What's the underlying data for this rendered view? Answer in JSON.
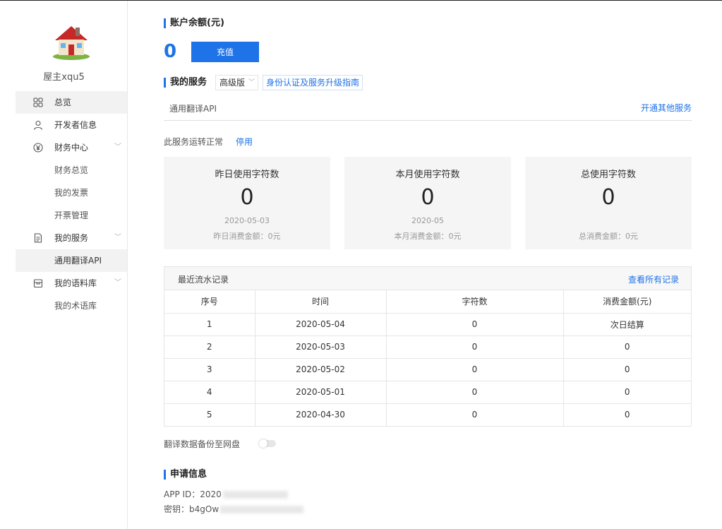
{
  "sidebar": {
    "username": "屋主xqu5",
    "items": [
      {
        "label": "总览",
        "icon": "overview-grid-icon"
      },
      {
        "label": "开发者信息",
        "icon": "user-icon"
      },
      {
        "label": "财务中心",
        "icon": "yuan-icon",
        "sub": [
          "财务总览",
          "我的发票",
          "开票管理"
        ]
      },
      {
        "label": "我的服务",
        "icon": "document-icon",
        "sub": [
          "通用翻译API"
        ]
      },
      {
        "label": "我的语料库",
        "icon": "box-icon",
        "sub": [
          "我的术语库"
        ]
      }
    ]
  },
  "account": {
    "title": "账户余额(元)",
    "balance": "0",
    "recharge_label": "充值"
  },
  "service": {
    "title": "我的服务",
    "tier": "高级版",
    "guide_link": "身份认证及服务升级指南",
    "tab": "通用翻译API",
    "open_other": "开通其他服务",
    "status": "此服务运转正常",
    "stop_label": "停用"
  },
  "cards": [
    {
      "title": "昨日使用字符数",
      "value": "0",
      "date": "2020-05-03",
      "fee": "昨日消费金额：0元"
    },
    {
      "title": "本月使用字符数",
      "value": "0",
      "date": "2020-05",
      "fee": "本月消费金额：0元"
    },
    {
      "title": "总使用字符数",
      "value": "0",
      "date": "",
      "fee": "总消费金额：0元"
    }
  ],
  "records": {
    "title": "最近流水记录",
    "view_all": "查看所有记录",
    "columns": [
      "序号",
      "时间",
      "字符数",
      "消费金额(元)"
    ],
    "rows": [
      [
        "1",
        "2020-05-04",
        "0",
        "次日结算"
      ],
      [
        "2",
        "2020-05-03",
        "0",
        "0"
      ],
      [
        "3",
        "2020-05-02",
        "0",
        "0"
      ],
      [
        "4",
        "2020-05-01",
        "0",
        "0"
      ],
      [
        "5",
        "2020-04-30",
        "0",
        "0"
      ]
    ]
  },
  "backup": {
    "label": "翻译数据备份至网盘"
  },
  "application": {
    "title": "申请信息",
    "app_id_label": "APP ID：",
    "app_id_visible": "2020",
    "key_label": "密钥：",
    "key_visible": "b4gOw"
  },
  "colors": {
    "accent": "#1e73e8",
    "card_bg": "#f5f5f5",
    "active_nav_bg": "#f2f2f2"
  }
}
